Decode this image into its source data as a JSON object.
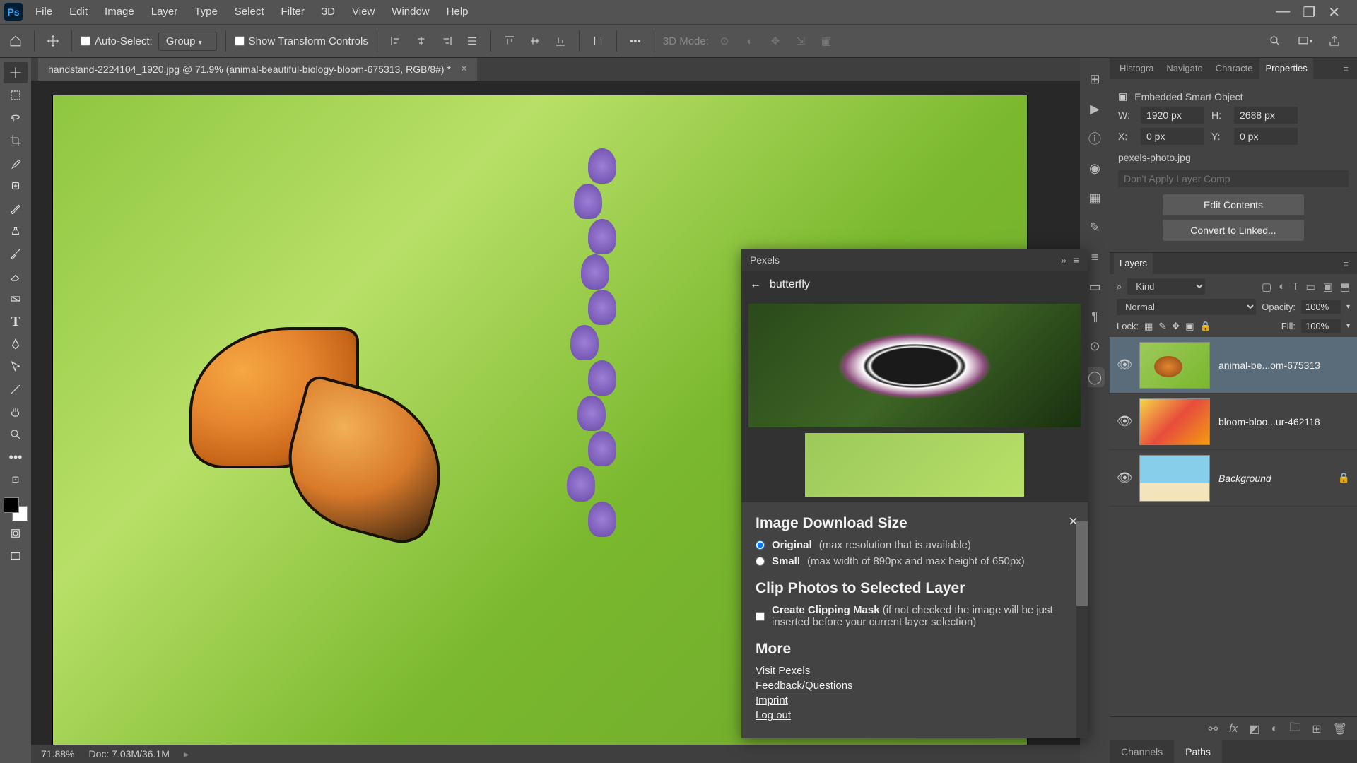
{
  "app": {
    "logo": "Ps"
  },
  "menu": [
    "File",
    "Edit",
    "Image",
    "Layer",
    "Type",
    "Select",
    "Filter",
    "3D",
    "View",
    "Window",
    "Help"
  ],
  "options": {
    "auto_select": "Auto-Select:",
    "group": "Group",
    "show_transform": "Show Transform Controls",
    "mode_3d": "3D Mode:"
  },
  "document": {
    "tab_title": "handstand-2224104_1920.jpg @ 71.9% (animal-beautiful-biology-bloom-675313, RGB/8#) *",
    "zoom": "71.88%",
    "doc_size": "Doc: 7.03M/36.1M"
  },
  "pexels": {
    "title": "Pexels",
    "search": "butterfly",
    "settings": {
      "size_heading": "Image Download Size",
      "original_label": "Original",
      "original_desc": "(max resolution that is available)",
      "small_label": "Small",
      "small_desc": "(max width of 890px and max height of 650px)",
      "clip_heading": "Clip Photos to Selected Layer",
      "clip_check_label": "Create Clipping Mask",
      "clip_check_desc": "(if not checked the image will be just inserted before your current layer selection)",
      "more_heading": "More",
      "links": [
        "Visit Pexels",
        "Feedback/Questions",
        "Imprint",
        "Log out"
      ]
    }
  },
  "properties": {
    "tabs": [
      "Histogra",
      "Navigato",
      "Characte",
      "Properties"
    ],
    "smart_label": "Embedded Smart Object",
    "W_label": "W:",
    "W": "1920 px",
    "H_label": "H:",
    "H": "2688 px",
    "X_label": "X:",
    "X": "0 px",
    "Y_label": "Y:",
    "Y": "0 px",
    "filename": "pexels-photo.jpg",
    "layer_comp_placeholder": "Don't Apply Layer Comp",
    "edit_contents": "Edit Contents",
    "convert_linked": "Convert to Linked..."
  },
  "layers": {
    "tab": "Layers",
    "kind": "Kind",
    "blend": "Normal",
    "opacity_label": "Opacity:",
    "opacity": "100%",
    "lock_label": "Lock:",
    "fill_label": "Fill:",
    "fill": "100%",
    "items": [
      {
        "name": "animal-be...om-675313",
        "selected": true,
        "locked": false
      },
      {
        "name": "bloom-bloo...ur-462118",
        "selected": false,
        "locked": false
      },
      {
        "name": "Background",
        "selected": false,
        "locked": true,
        "italic": true
      }
    ],
    "bottom_tabs": [
      "Channels",
      "Paths"
    ]
  }
}
